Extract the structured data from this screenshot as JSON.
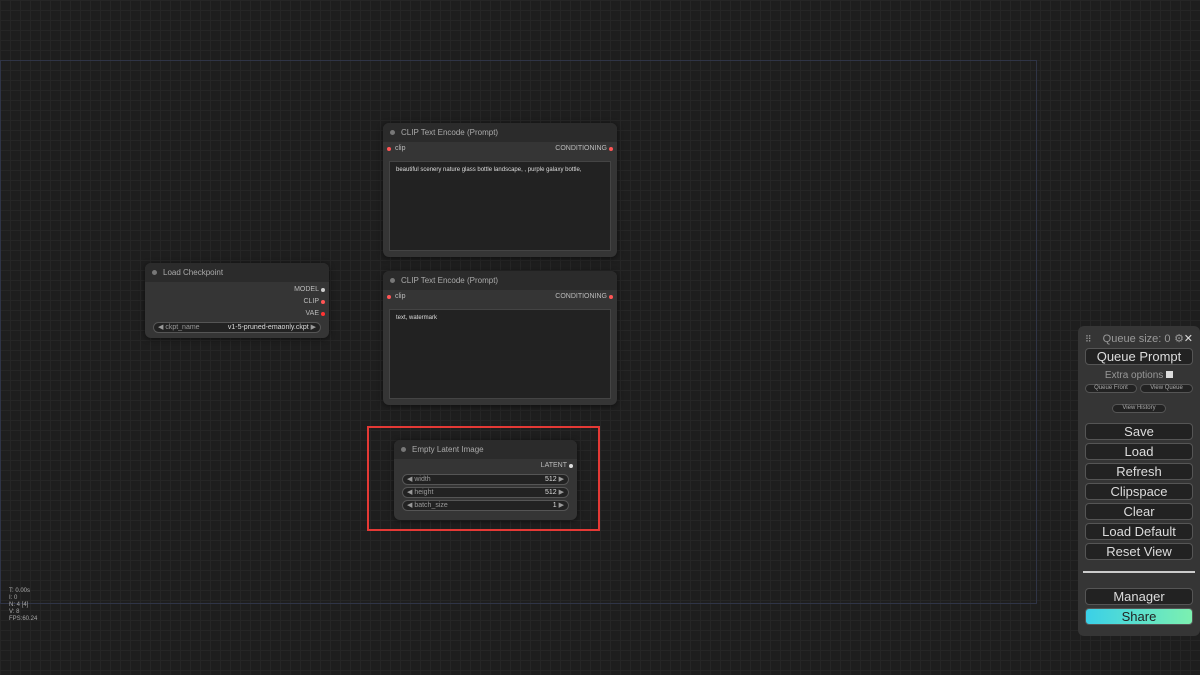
{
  "nodes": {
    "checkpoint": {
      "title": "Load Checkpoint",
      "outputs": [
        "MODEL",
        "CLIP",
        "VAE"
      ],
      "widget": {
        "name": "ckpt_name",
        "value": "v1-5-pruned-emaonly.ckpt"
      }
    },
    "clip1": {
      "title": "CLIP Text Encode (Prompt)",
      "input": "clip",
      "output": "CONDITIONING",
      "text": "beautiful scenery nature glass bottle landscape, , purple galaxy bottle,"
    },
    "clip2": {
      "title": "CLIP Text Encode (Prompt)",
      "input": "clip",
      "output": "CONDITIONING",
      "text": "text, watermark"
    },
    "latent": {
      "title": "Empty Latent Image",
      "output": "LATENT",
      "widgets": [
        {
          "name": "width",
          "value": "512"
        },
        {
          "name": "height",
          "value": "512"
        },
        {
          "name": "batch_size",
          "value": "1"
        }
      ]
    }
  },
  "panel": {
    "queue_size": "Queue size: 0",
    "queue_prompt": "Queue Prompt",
    "extra_options": "Extra options",
    "queue_front": "Queue Front",
    "view_queue": "View Queue",
    "view_history": "View History",
    "buttons": [
      "Save",
      "Load",
      "Refresh",
      "Clipspace",
      "Clear",
      "Load Default",
      "Reset View"
    ],
    "manager": "Manager",
    "share": "Share"
  },
  "stats": [
    "T: 0.00s",
    "I: 0",
    "N: 4 [4]",
    "V: 8",
    "FPS:60.24"
  ],
  "colors": {
    "highlight": "#e53935",
    "clip_slot": "#ff5a5a",
    "share_gradient": [
      "#3ad0e8",
      "#7cf0b0"
    ]
  }
}
